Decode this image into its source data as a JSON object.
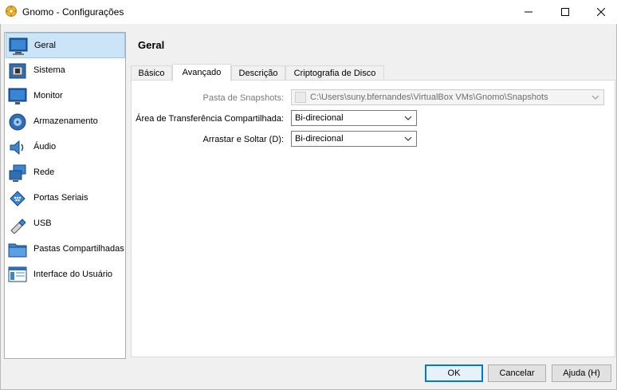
{
  "window": {
    "title": "Gnomo - Configurações"
  },
  "sidebar": {
    "items": [
      {
        "label": "Geral",
        "icon": "general-icon",
        "selected": true
      },
      {
        "label": "Sistema",
        "icon": "system-icon",
        "selected": false
      },
      {
        "label": "Monitor",
        "icon": "monitor-icon",
        "selected": false
      },
      {
        "label": "Armazenamento",
        "icon": "storage-icon",
        "selected": false
      },
      {
        "label": "Áudio",
        "icon": "audio-icon",
        "selected": false
      },
      {
        "label": "Rede",
        "icon": "network-icon",
        "selected": false
      },
      {
        "label": "Portas Seriais",
        "icon": "serial-ports-icon",
        "selected": false
      },
      {
        "label": "USB",
        "icon": "usb-icon",
        "selected": false
      },
      {
        "label": "Pastas Compartilhadas",
        "icon": "shared-folders-icon",
        "selected": false
      },
      {
        "label": "Interface do Usuário",
        "icon": "user-interface-icon",
        "selected": false
      }
    ]
  },
  "page": {
    "title": "Geral"
  },
  "tabs": [
    {
      "label": "Básico",
      "active": false
    },
    {
      "label": "Avançado",
      "active": true
    },
    {
      "label": "Descrição",
      "active": false
    },
    {
      "label": "Criptografia de Disco",
      "active": false
    }
  ],
  "fields": {
    "snapshot_label": "Pasta de Snapshots:",
    "snapshot_value": "C:\\Users\\suny.bfernandes\\VirtualBox VMs\\Gnomo\\Snapshots",
    "clipboard_label": "Área de Transferência Compartilhada:",
    "clipboard_value": "Bi-direcional",
    "dragdrop_label": "Arrastar e Soltar (D):",
    "dragdrop_value": "Bi-direcional"
  },
  "buttons": {
    "ok": "OK",
    "cancel": "Cancelar",
    "help": "Ajuda (H)"
  },
  "colors": {
    "selection_bg": "#cce4f7",
    "default_button_border": "#0078d7"
  }
}
